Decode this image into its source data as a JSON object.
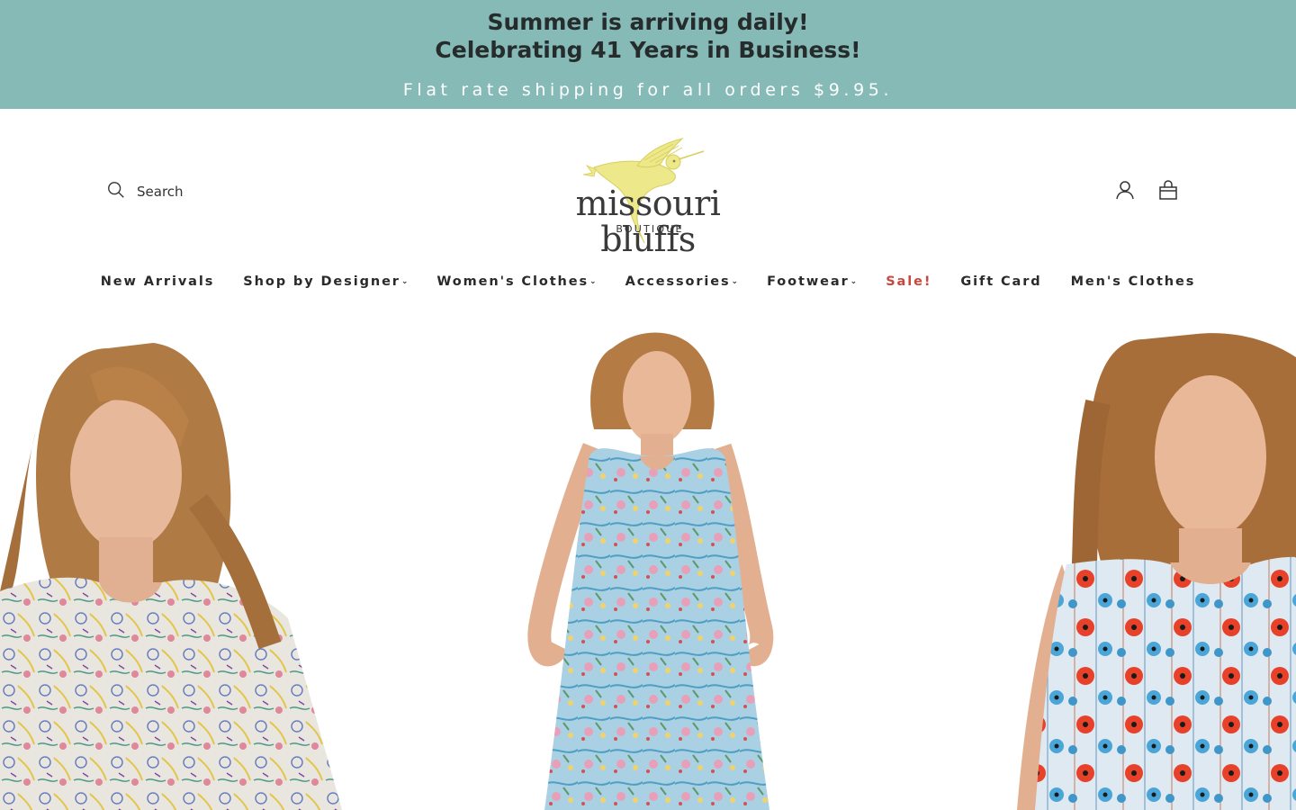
{
  "announcement": {
    "line1": "Summer is arriving daily!",
    "line2": "Celebrating 41 Years in Business!",
    "line3": "Flat rate shipping for all orders $9.95.",
    "background": "#86bab7"
  },
  "header": {
    "search_label": "Search",
    "logo_wordmark": "missouri bluffs",
    "logo_subtitle": "BOUTIQUE",
    "account_icon": "user-icon",
    "cart_icon": "bag-icon"
  },
  "nav": {
    "items": [
      {
        "label": "New Arrivals",
        "dropdown": false
      },
      {
        "label": "Shop by Designer",
        "dropdown": true
      },
      {
        "label": "Women's Clothes",
        "dropdown": true
      },
      {
        "label": "Accessories",
        "dropdown": true
      },
      {
        "label": "Footwear",
        "dropdown": true
      },
      {
        "label": "Sale!",
        "dropdown": false
      },
      {
        "label": "Gift Card",
        "dropdown": false
      },
      {
        "label": "Men's Clothes",
        "dropdown": false
      }
    ],
    "sale_color": "#c9473c"
  },
  "colors": {
    "accent": "#86bab7",
    "logo_bird": "#ede88a"
  }
}
